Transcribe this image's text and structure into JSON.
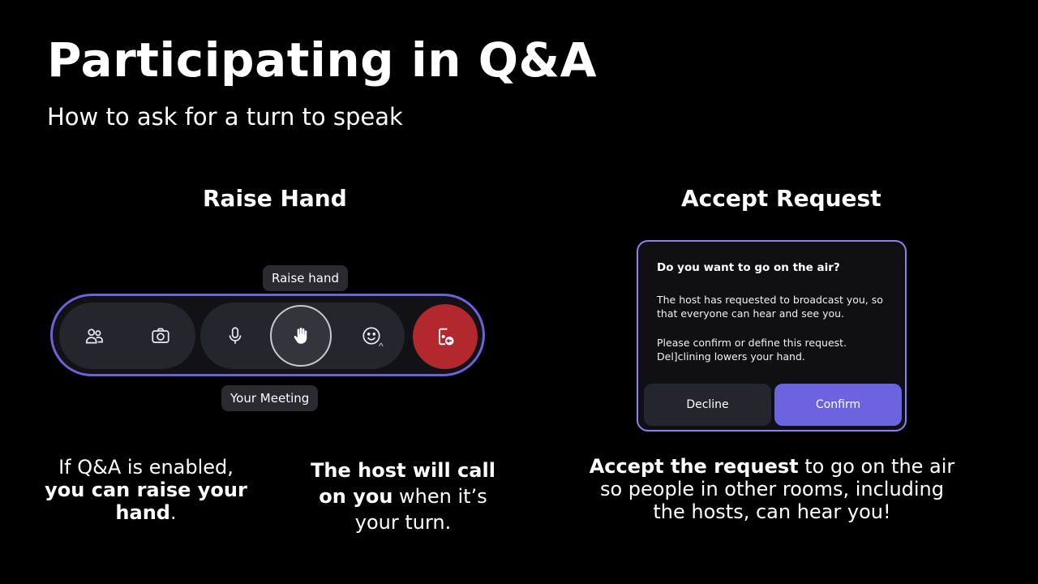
{
  "slide": {
    "title": "Participating in Q&A",
    "subtitle": "How to ask for a turn to speak"
  },
  "raise_section": {
    "heading": "Raise Hand",
    "tooltip_top": "Raise hand",
    "tooltip_bottom": "Your Meeting",
    "toolbar_icons": [
      "people-icon",
      "camera-icon",
      "microphone-icon",
      "raise-hand-icon",
      "emoji-icon",
      "chevron-up-icon",
      "leave-icon"
    ],
    "colors": {
      "toolbar_border": "#6b63d6",
      "leave_button": "#b3282f"
    }
  },
  "accept_section": {
    "heading": "Accept Request",
    "dialog": {
      "title": "Do you want to go on the air?",
      "body1": "The host has requested to broadcast you, so that everyone can hear and see you.",
      "body2_line1": "Please confirm or define this request.",
      "body2_line2": "Del]clining lowers your hand.",
      "decline_label": "Decline",
      "confirm_label": "Confirm"
    },
    "colors": {
      "confirm_button": "#6b63e0",
      "dialog_border": "#8b83f0"
    }
  },
  "captions": {
    "raise": {
      "plain1": "If Q&A is enabled,",
      "bold1": "you can raise your hand",
      "plain2": "."
    },
    "host": {
      "bold1": "The host will call on you",
      "plain1": " when it’s your turn."
    },
    "accept": {
      "bold1": "Accept the request",
      "plain1": " to go on the air so people in other rooms, including the hosts, can hear you!"
    }
  }
}
